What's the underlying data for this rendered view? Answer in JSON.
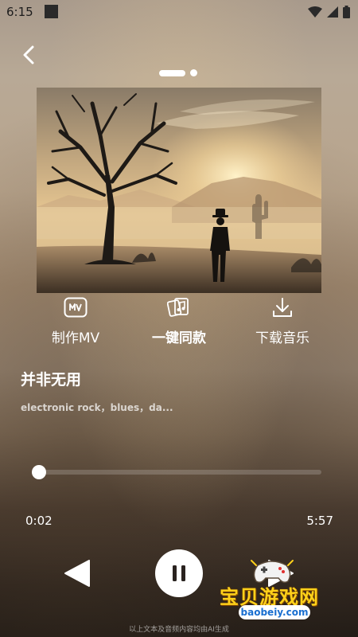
{
  "status_bar": {
    "time": "6:15"
  },
  "icons": {
    "back": "chevron-left-icon",
    "wifi": "wifi-icon",
    "signal": "cellular-signal-icon",
    "battery": "battery-icon",
    "make_mv": "mv-icon",
    "one_click": "cards-music-icon",
    "download": "download-icon",
    "prev": "play-previous-icon",
    "pause": "pause-icon",
    "next": "play-next-icon"
  },
  "actions": [
    {
      "label": "制作MV"
    },
    {
      "label": "一键同款"
    },
    {
      "label": "下载音乐"
    }
  ],
  "song": {
    "title": "并非无用",
    "tags": "electronic rock，blues，da..."
  },
  "player": {
    "current_time": "0:02",
    "total_time": "5:57",
    "progress_fraction": 0.006
  },
  "watermark": {
    "text": "宝贝游戏网",
    "url": "baobeiy.com"
  },
  "disclaimer": "以上文本及音频内容均由AI生成",
  "colors": {
    "accent": "#ffffff",
    "watermark_yellow": "#ffd11a",
    "watermark_blue": "#1a6fd0"
  }
}
